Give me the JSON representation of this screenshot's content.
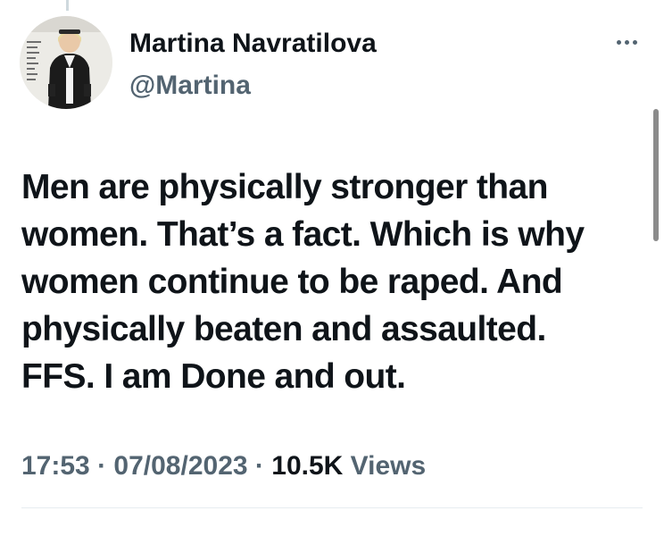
{
  "tweet": {
    "author": {
      "display_name": "Martina Navratilova",
      "handle": "@Martina",
      "avatar_icon": "profile-photo"
    },
    "text_lines": [
      "Men are physically stronger than",
      "women. That’s a fact. Which is why",
      "women continue to be raped. And",
      "physically beaten and assaulted.",
      "FFS. I am Done and out."
    ],
    "time": "17:53",
    "date": "07/08/2023",
    "separator": "·",
    "views_count": "10.5K",
    "views_label": "Views",
    "more_icon": "more-horizontal-icon"
  },
  "colors": {
    "text_primary": "#0f1419",
    "text_secondary": "#536471",
    "divider": "#e6ecf0"
  }
}
